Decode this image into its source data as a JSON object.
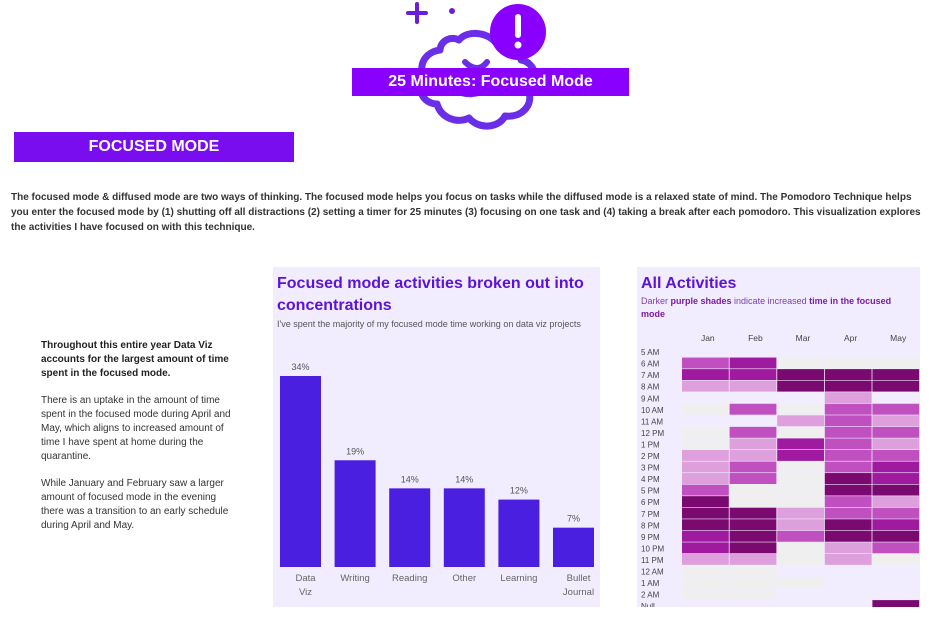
{
  "banner": {
    "title": "25 Minutes: Focused Mode"
  },
  "section": {
    "title": "FOCUSED MODE"
  },
  "intro": {
    "text": "The focused mode & diffused mode are two ways of thinking. The focused mode helps you focus on tasks while the diffused mode is a relaxed state of mind. The Pomodoro Technique helps you enter the focused mode by (1) shutting off all distractions (2) setting a timer for 25 minutes (3) focusing on one task and (4) taking a break after each pomodoro.  This visualization explores the activities I have focused on with this technique."
  },
  "notes": {
    "lead": "Throughout this entire year Data Viz accounts for the largest amount of time spent in the focused mode.",
    "p2": "There is an uptake in the amount of time spent in the focused mode during April and May, which aligns to increased amount of time I have spent at home during the quarantine.",
    "p3": "While January and February saw a larger amount of focused mode in the evening there was a transition to an early schedule during April and May."
  },
  "bar_panel": {
    "title": "Focused mode activities broken out into concentrations",
    "subtitle": "I've spent the majority of my focused mode time working on data viz projects"
  },
  "heat_panel": {
    "title": "All Activities",
    "subtitle_a": "Darker ",
    "subtitle_b": "purple shades",
    "subtitle_c": " indicate increased ",
    "subtitle_d": "time in the focused mode"
  },
  "colors": {
    "bar": "#4b1fe0",
    "banner": "#8a00ff",
    "heat_scale": [
      "#efefef",
      "#dda0dd",
      "#c050c0",
      "#a01aa0",
      "#7a0a70"
    ]
  },
  "chart_data": [
    {
      "type": "bar",
      "title": "Focused mode activities broken out into concentrations",
      "categories": [
        "Data Viz",
        "Writing",
        "Reading",
        "Other",
        "Learning",
        "Bullet Journal"
      ],
      "values": [
        34,
        19,
        14,
        14,
        12,
        7
      ],
      "labels": [
        "34%",
        "19%",
        "14%",
        "14%",
        "12%",
        "7%"
      ],
      "ylim": [
        0,
        34
      ]
    },
    {
      "type": "heatmap",
      "title": "All Activities",
      "x": [
        "Jan",
        "Feb",
        "Mar",
        "Apr",
        "May"
      ],
      "y": [
        "5 AM",
        "6 AM",
        "7 AM",
        "8 AM",
        "9 AM",
        "10 AM",
        "11 AM",
        "12 PM",
        "1 PM",
        "2 PM",
        "3 PM",
        "4 PM",
        "5 PM",
        "6 PM",
        "7 PM",
        "8 PM",
        "9 PM",
        "10 PM",
        "11 PM",
        "12 AM",
        "1 AM",
        "2 AM",
        "Null"
      ],
      "values": [
        [
          null,
          null,
          null,
          null,
          null
        ],
        [
          2,
          3,
          0,
          0,
          0
        ],
        [
          3,
          3,
          4,
          4,
          4
        ],
        [
          1,
          1,
          4,
          4,
          4
        ],
        [
          null,
          null,
          null,
          1,
          null
        ],
        [
          0,
          2,
          0,
          2,
          2
        ],
        [
          null,
          null,
          1,
          2,
          1
        ],
        [
          0,
          2,
          0,
          2,
          2
        ],
        [
          0,
          1,
          3,
          2,
          1
        ],
        [
          1,
          1,
          3,
          2,
          2
        ],
        [
          1,
          2,
          0,
          2,
          3
        ],
        [
          1,
          2,
          0,
          4,
          3
        ],
        [
          2,
          0,
          0,
          4,
          4
        ],
        [
          4,
          0,
          0,
          2,
          1
        ],
        [
          4,
          4,
          1,
          2,
          2
        ],
        [
          4,
          4,
          1,
          4,
          3
        ],
        [
          3,
          4,
          2,
          4,
          4
        ],
        [
          3,
          4,
          0,
          1,
          2
        ],
        [
          1,
          1,
          0,
          1,
          0
        ],
        [
          0,
          0,
          null,
          null,
          null
        ],
        [
          0,
          0,
          0,
          null,
          null
        ],
        [
          0,
          0,
          null,
          null,
          null
        ],
        [
          null,
          null,
          null,
          null,
          4
        ]
      ]
    }
  ]
}
